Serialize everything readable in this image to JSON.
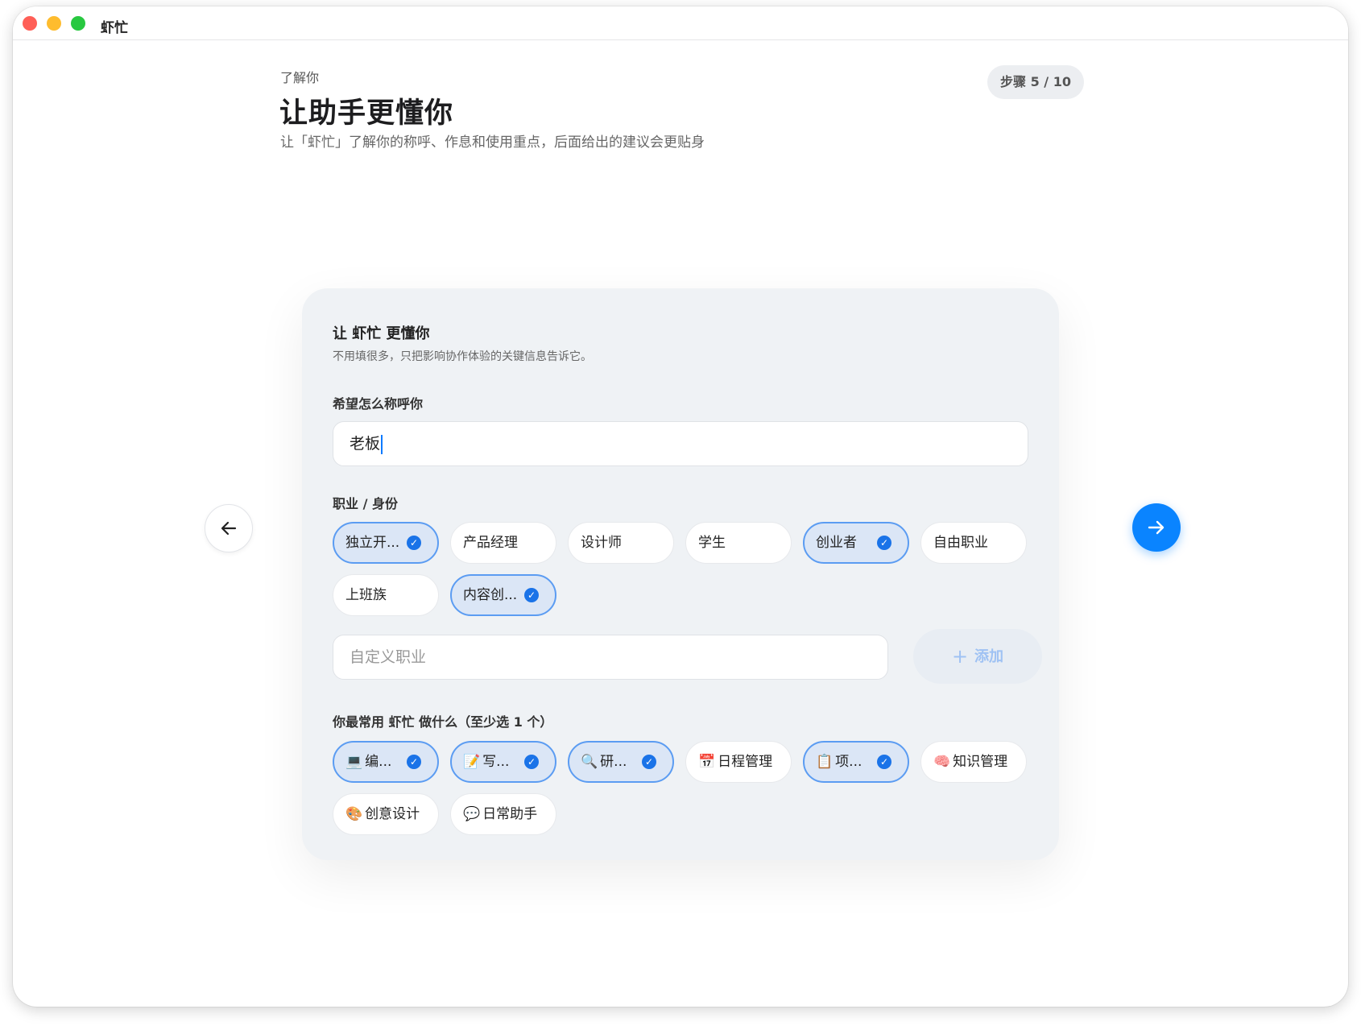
{
  "window": {
    "title": "虾忙"
  },
  "header": {
    "eyebrow": "了解你",
    "title": "让助手更懂你",
    "subtitle": "让「虾忙」了解你的称呼、作息和使用重点，后面给出的建议会更贴身",
    "step": "步骤 5 / 10"
  },
  "card": {
    "title": "让 虾忙 更懂你",
    "subtitle": "不用填很多，只把影响协作体验的关键信息告诉它。",
    "name_label": "希望怎么称呼你",
    "name_value": "老板",
    "occupation_label": "职业 / 身份",
    "occupations": [
      {
        "label": "独立开...",
        "selected": true
      },
      {
        "label": "产品经理",
        "selected": false
      },
      {
        "label": "设计师",
        "selected": false
      },
      {
        "label": "学生",
        "selected": false
      },
      {
        "label": "创业者",
        "selected": true
      },
      {
        "label": "自由职业",
        "selected": false
      },
      {
        "label": "上班族",
        "selected": false
      },
      {
        "label": "内容创...",
        "selected": true
      }
    ],
    "custom_placeholder": "自定义职业",
    "add_label": "添加",
    "usage_label": "你最常用 虾忙 做什么（至少选 1 个）",
    "usages": [
      {
        "emoji": "💻",
        "label": "编...",
        "selected": true
      },
      {
        "emoji": "📝",
        "label": "写...",
        "selected": true
      },
      {
        "emoji": "🔍",
        "label": "研...",
        "selected": true
      },
      {
        "emoji": "📅",
        "label": "日程管理",
        "selected": false
      },
      {
        "emoji": "📋",
        "label": "项...",
        "selected": true
      },
      {
        "emoji": "🧠",
        "label": "知识管理",
        "selected": false
      },
      {
        "emoji": "🎨",
        "label": "创意设计",
        "selected": false
      },
      {
        "emoji": "💬",
        "label": "日常助手",
        "selected": false
      }
    ]
  },
  "colors": {
    "accent": "#0a84ff",
    "chip_selected_bg": "#dbe6f6",
    "chip_selected_border": "#5b9cf2",
    "card_bg": "#eff2f5"
  },
  "icons": {
    "prev": "arrow-left-icon",
    "next": "arrow-right-icon",
    "check": "check-circle-icon",
    "add": "plus-icon"
  }
}
